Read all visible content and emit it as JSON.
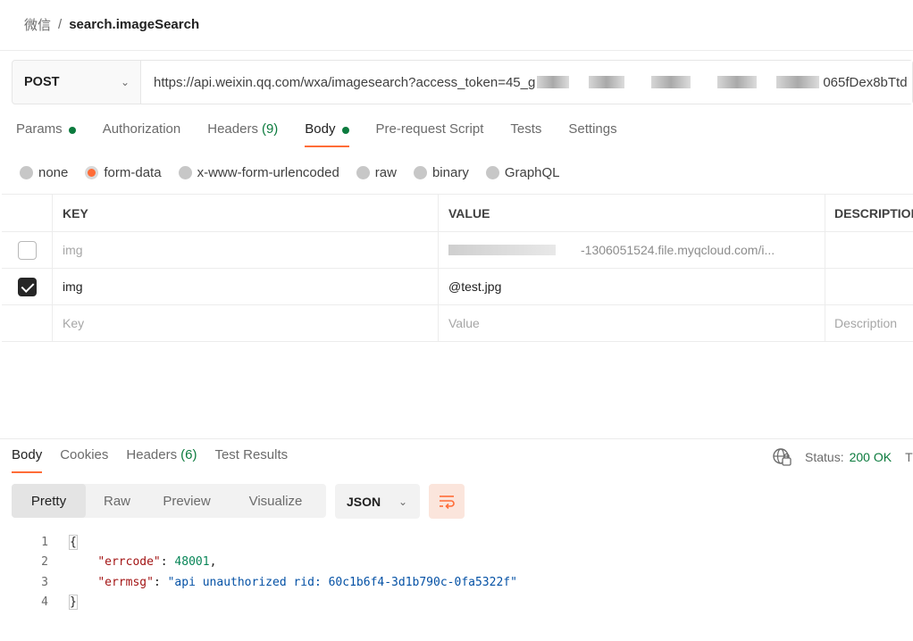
{
  "breadcrumb": {
    "parent": "微信",
    "separator": "/",
    "current": "search.imageSearch"
  },
  "request": {
    "method": "POST",
    "url_prefix": "https://api.weixin.qq.com/wxa/imagesearch?access_token=45_g",
    "url_suffix": "065fDex8bTtd"
  },
  "request_tabs": [
    {
      "label": "Params",
      "dot": true
    },
    {
      "label": "Authorization"
    },
    {
      "label": "Headers",
      "count": "(9)"
    },
    {
      "label": "Body",
      "dot": true,
      "active": true
    },
    {
      "label": "Pre-request Script"
    },
    {
      "label": "Tests"
    },
    {
      "label": "Settings"
    }
  ],
  "body_types": [
    {
      "label": "none"
    },
    {
      "label": "form-data",
      "selected": true
    },
    {
      "label": "x-www-form-urlencoded"
    },
    {
      "label": "raw"
    },
    {
      "label": "binary"
    },
    {
      "label": "GraphQL"
    }
  ],
  "params_table": {
    "headers": {
      "key": "KEY",
      "value": "VALUE",
      "description": "DESCRIPTION"
    },
    "rows": [
      {
        "key": "img",
        "value": "-1306051524.file.myqcloud.com/i...",
        "checked": false,
        "disabled": true
      },
      {
        "key": "img",
        "value": "@test.jpg",
        "checked": true,
        "disabled": false
      }
    ],
    "placeholders": {
      "key": "Key",
      "value": "Value",
      "description": "Description"
    }
  },
  "response_tabs": [
    {
      "label": "Body",
      "active": true
    },
    {
      "label": "Cookies"
    },
    {
      "label": "Headers",
      "count": "(6)"
    },
    {
      "label": "Test Results"
    }
  ],
  "status": {
    "label": "Status:",
    "value": "200 OK",
    "trailing": "T"
  },
  "view_tabs": [
    {
      "label": "Pretty",
      "active": true
    },
    {
      "label": "Raw"
    },
    {
      "label": "Preview"
    },
    {
      "label": "Visualize"
    }
  ],
  "format": "JSON",
  "colors": {
    "accent": "#ff6c37",
    "success": "#0c7b3e"
  },
  "icons": {
    "method_dropdown": "chevron-down-icon",
    "status": "globe-icon",
    "wrap": "wrap-lines-icon"
  },
  "code": {
    "line_numbers": [
      "1",
      "2",
      "3",
      "4"
    ],
    "open_brace": "{",
    "close_brace": "}",
    "errcode_key": "\"errcode\"",
    "errcode_value": "48001",
    "errmsg_key": "\"errmsg\"",
    "errmsg_value": "\"api unauthorized rid: 60c1b6f4-3d1b790c-0fa5322f\""
  }
}
